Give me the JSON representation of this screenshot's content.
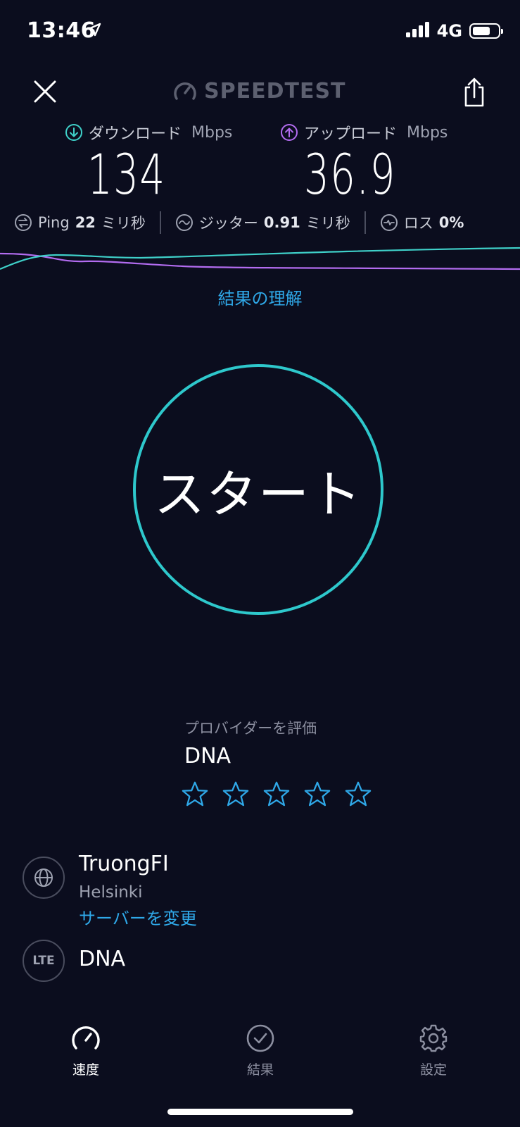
{
  "status_bar": {
    "time": "13:46",
    "network": "4G"
  },
  "header": {
    "logo_text": "SPEEDTEST"
  },
  "metrics": {
    "download": {
      "label": "ダウンロード",
      "unit": "Mbps",
      "value": "134",
      "color": "#3fd0c9"
    },
    "upload": {
      "label": "アップロード",
      "unit": "Mbps",
      "value": "36.9",
      "color": "#b36cf0"
    },
    "ping": {
      "label": "Ping",
      "value": "22",
      "unit": "ミリ秒"
    },
    "jitter": {
      "label": "ジッター",
      "value": "0.91",
      "unit": "ミリ秒"
    },
    "loss": {
      "label": "ロス",
      "value": "0%"
    }
  },
  "understand_link": "結果の理解",
  "start_button": {
    "label": "スタート",
    "color": "#2ec8cc"
  },
  "rating": {
    "prompt": "プロバイダーを評価",
    "provider": "DNA",
    "stars_total": 5,
    "stars_filled": 0,
    "star_color": "#2fa8e8"
  },
  "server": {
    "name": "TruongFI",
    "city": "Helsinki",
    "change_label": "サーバーを変更"
  },
  "connection": {
    "type_badge": "LTE",
    "isp": "DNA"
  },
  "tabs": [
    {
      "label": "速度",
      "icon": "speedometer-icon",
      "active": true
    },
    {
      "label": "結果",
      "icon": "check-circle-icon",
      "active": false
    },
    {
      "label": "設定",
      "icon": "gear-icon",
      "active": false
    }
  ],
  "colors": {
    "background": "#0b0d1e",
    "accent_link": "#2fa8e8"
  }
}
